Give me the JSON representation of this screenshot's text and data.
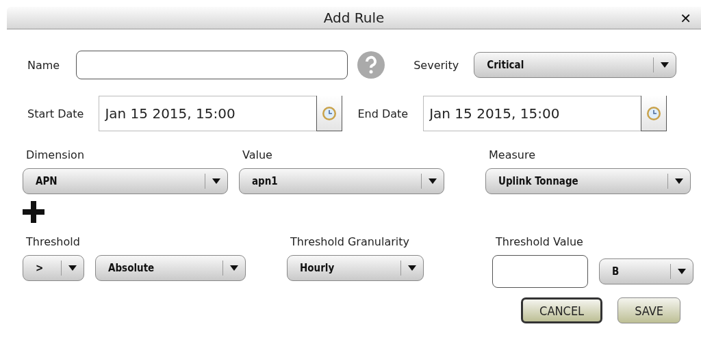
{
  "dialog": {
    "title": "Add Rule",
    "close": "✕"
  },
  "name": {
    "label": "Name"
  },
  "severity": {
    "label": "Severity",
    "value": "Critical"
  },
  "start_date": {
    "label": "Start Date",
    "value": "Jan 15 2015, 15:00"
  },
  "end_date": {
    "label": "End Date",
    "value": "Jan 15 2015, 15:00"
  },
  "rule_fields": [
    {
      "label": "Dimension",
      "value": "APN"
    },
    {
      "label": "Value",
      "value": "apn1"
    },
    {
      "label": "Measure",
      "value": "Uplink Tonnage"
    }
  ],
  "threshold": {
    "label": "Threshold",
    "operator": ">",
    "mode": "Absolute"
  },
  "granularity": {
    "label": "Threshold Granularity",
    "value": "Hourly"
  },
  "threshold_value": {
    "label": "Threshold Value",
    "unit": "B"
  },
  "buttons": [
    {
      "label": "CANCEL",
      "focused": true
    },
    {
      "label": "SAVE",
      "focused": false
    }
  ]
}
